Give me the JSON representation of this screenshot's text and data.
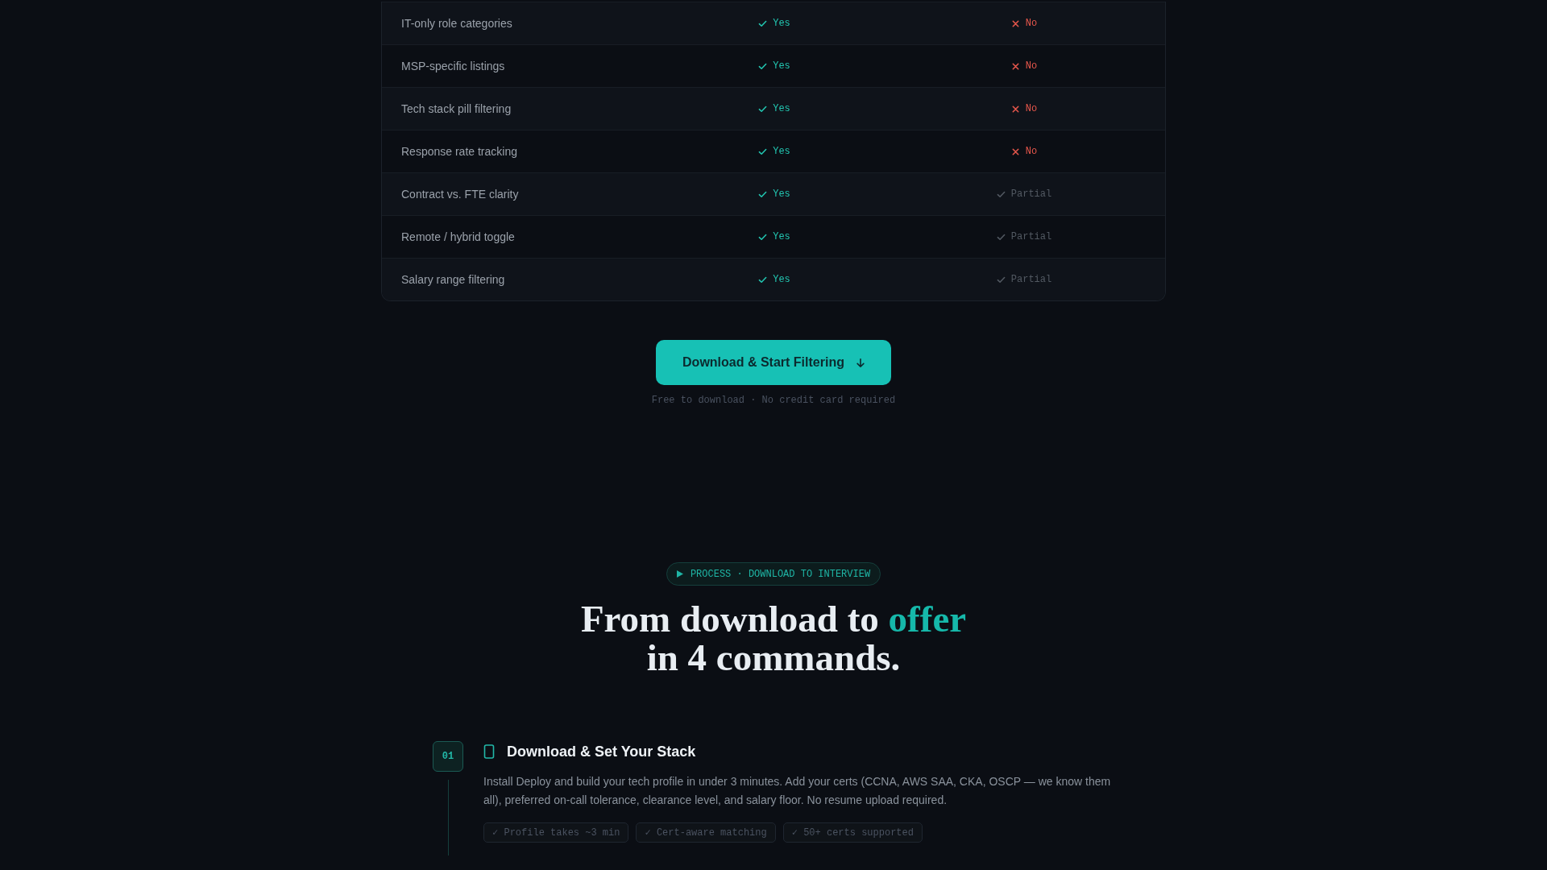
{
  "comparison_table": {
    "rows": [
      {
        "feature": "IT-only role categories",
        "cells": [
          {
            "kind": "yes",
            "text": "Yes"
          },
          {
            "kind": "no",
            "text": "No"
          }
        ]
      },
      {
        "feature": "MSP-specific listings",
        "cells": [
          {
            "kind": "yes",
            "text": "Yes"
          },
          {
            "kind": "no",
            "text": "No"
          }
        ]
      },
      {
        "feature": "Tech stack pill filtering",
        "cells": [
          {
            "kind": "yes",
            "text": "Yes"
          },
          {
            "kind": "no",
            "text": "No"
          }
        ]
      },
      {
        "feature": "Response rate tracking",
        "cells": [
          {
            "kind": "yes",
            "text": "Yes"
          },
          {
            "kind": "no",
            "text": "No"
          }
        ]
      },
      {
        "feature": "Contract vs. FTE clarity",
        "cells": [
          {
            "kind": "yes",
            "text": "Yes"
          },
          {
            "kind": "partial",
            "text": "Partial"
          }
        ]
      },
      {
        "feature": "Remote / hybrid toggle",
        "cells": [
          {
            "kind": "yes",
            "text": "Yes"
          },
          {
            "kind": "partial",
            "text": "Partial"
          }
        ]
      },
      {
        "feature": "Salary range filtering",
        "cells": [
          {
            "kind": "yes",
            "text": "Yes"
          },
          {
            "kind": "partial",
            "text": "Partial"
          }
        ]
      }
    ]
  },
  "cta": {
    "label": "Download & Start Filtering",
    "note": "Free to download · No credit card required"
  },
  "process": {
    "badge": "PROCESS · DOWNLOAD TO INTERVIEW",
    "heading": {
      "lines": [
        [
          {
            "text": "From download to ",
            "accent": false
          },
          {
            "text": "offer",
            "accent": true
          }
        ],
        [
          {
            "text": "in 4 commands.",
            "accent": false
          }
        ]
      ]
    },
    "steps": [
      {
        "number": "01",
        "title": "Download & Set Your Stack",
        "description": "Install Deploy and build your tech profile in under 3 minutes. Add your certs (CCNA, AWS SAA, CKA, OSCP — we know them all), preferred on-call tolerance, clearance level, and salary floor. No resume upload required.",
        "tags": [
          "✓ Profile takes ~3 min",
          "✓ Cert-aware matching",
          "✓ 50+ certs supported"
        ]
      }
    ]
  }
}
